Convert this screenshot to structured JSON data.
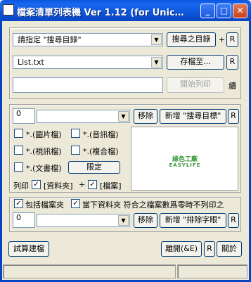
{
  "window": {
    "title": "檔案清單列表機 Ver 1.12 (for Unic…",
    "min": "_",
    "max": "□",
    "close": "✕"
  },
  "top": {
    "search_dir_combo": "請指定 \"搜尋目錄\"",
    "search_dir_button": "搜尋之目錄",
    "plus": "+",
    "r1": "R",
    "output_combo": "List.txt",
    "save_to_button": "存檔至...",
    "r2": "R",
    "start_button": "開始列印",
    "continue_label": "續"
  },
  "filter": {
    "count1": "0",
    "remove1": "移除",
    "add_target": "新增 \"搜尋目標\"",
    "r3": "R",
    "types": [
      "*.(圖片檔)",
      "*.(音訊檔)",
      "*.(視訊檔)",
      "*.(複合檔)",
      "*.(文書檔)"
    ],
    "limit_button": "限定",
    "print_label": "列印",
    "folder_label": "[資料夾]",
    "plus2": "+",
    "file_label": "[檔案]",
    "logo_top": "綠色工廠",
    "logo_bottom": "EASYLIFE"
  },
  "options": {
    "include_subfolders": "包括檔案夾",
    "skip_zero": "當下資料夾 符合之檔案數爲零時不列印之",
    "count2": "0",
    "remove2": "移除",
    "add_exclude": "新增 \"排除字眼\"",
    "r4": "R"
  },
  "bottom": {
    "estimate_button": "試算建檔",
    "close_button": "離開(&E)",
    "r5": "R",
    "about_button": "關於"
  }
}
